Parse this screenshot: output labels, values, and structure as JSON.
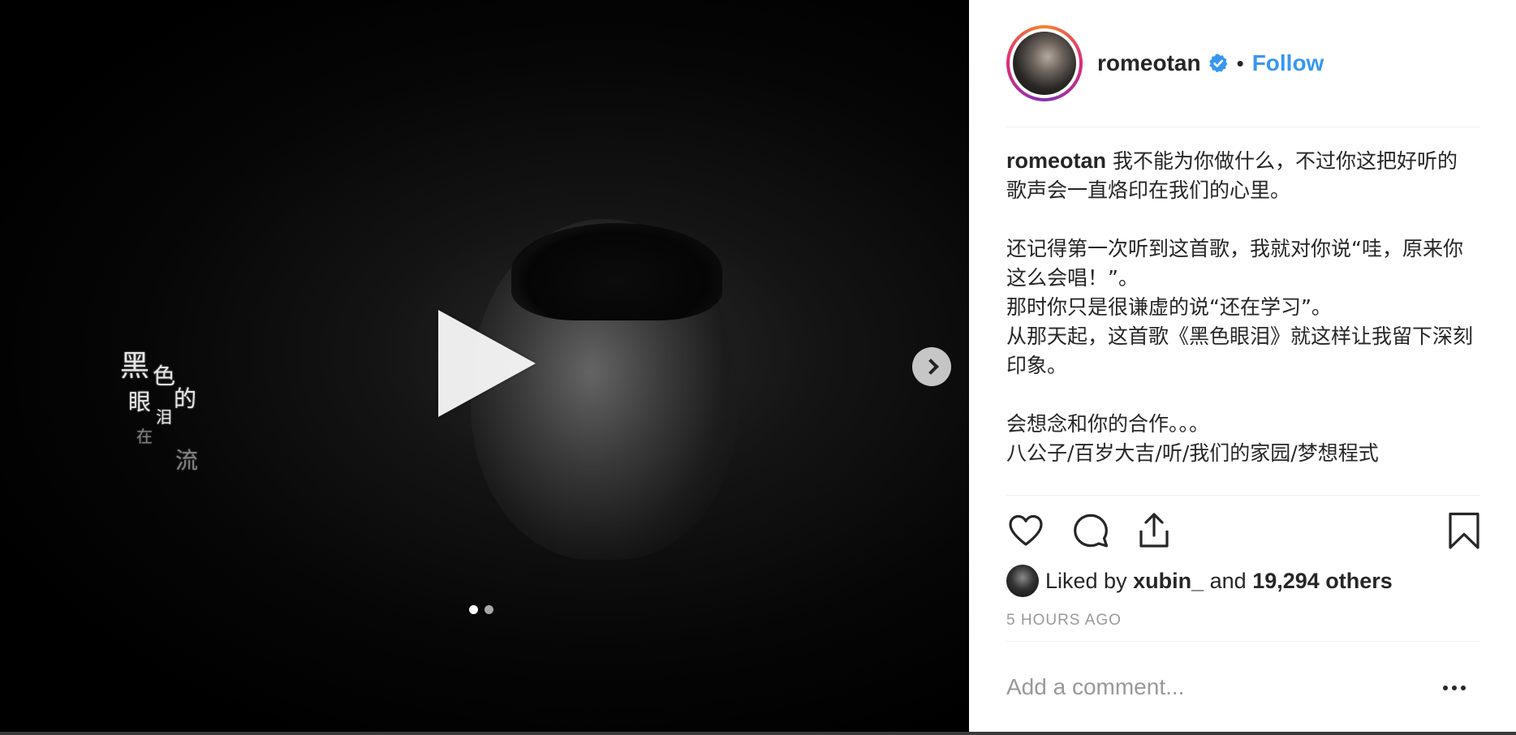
{
  "post": {
    "username": "romeotan",
    "follow_label": "Follow",
    "separator": "•",
    "caption_user": "romeotan",
    "caption_lines": [
      "我不能为你做什么，不过你这把好听的歌声会一直烙印在我们的心里。",
      "还记得第一次听到这首歌，我就对你说“哇，原来你这么会唱！”。",
      "那时你只是很谦虚的说“还在学习”。",
      "从那天起，这首歌《黑色眼泪》就这样让我留下深刻印象。",
      "会想念和你的合作。。。",
      "八公子/百岁大吉/听/我们的家园/梦想程式"
    ],
    "likes": {
      "prefix": "Liked by",
      "first_user": "xubin_",
      "and": "and",
      "others": "19,294 others"
    },
    "timestamp": "5 HOURS AGO",
    "comment_placeholder": "Add a comment..."
  },
  "media": {
    "lyrics": [
      "黑",
      "色",
      "的",
      "眼",
      "泪",
      "在",
      "流"
    ],
    "carousel": {
      "current": 1,
      "total": 2
    }
  },
  "icons": {
    "verified": "verified-badge-icon",
    "like": "heart-icon",
    "comment": "comment-bubble-icon",
    "share": "share-icon",
    "save": "bookmark-icon",
    "next": "chevron-right-icon",
    "play": "play-icon",
    "more": "more-options-icon"
  },
  "colors": {
    "link": "#3897f0",
    "verified": "#3897f0",
    "text": "#262626",
    "muted": "#999999"
  }
}
